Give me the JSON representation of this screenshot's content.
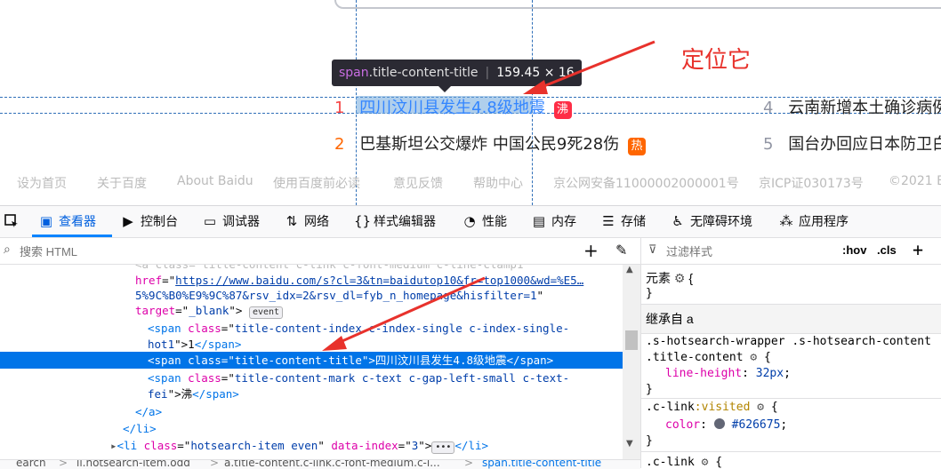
{
  "tooltip": {
    "tag": "span",
    "cls": ".title-content-title",
    "size": "159.45 × 16"
  },
  "annotation": "定位它",
  "hotsearch": [
    {
      "index": "1",
      "title": "四川汶川县发生4.8级地震",
      "badge": "沸"
    },
    {
      "index": "2",
      "title": "巴基斯坦公交爆炸 中国公民9死28伤",
      "badge": "热"
    },
    {
      "index": "4",
      "title": "云南新增本土确诊病例"
    },
    {
      "index": "5",
      "title": "国台办回应日本防卫白"
    }
  ],
  "footer": [
    "设为首页",
    "关于百度",
    "About Baidu",
    "使用百度前必读",
    "意见反馈",
    "帮助中心",
    "京公网安备11000002000001号",
    "京ICP证030173号",
    "©2021 B"
  ],
  "toolbar": {
    "inspector": "查看器",
    "console": "控制台",
    "debugger": "调试器",
    "network": "网络",
    "style_editor": "样式编辑器",
    "performance": "性能",
    "memory": "内存",
    "storage": "存储",
    "accessibility": "无障碍环境",
    "application": "应用程序"
  },
  "search_html_placeholder": "搜索 HTML",
  "filter_styles_placeholder": "过滤样式",
  "hov": ":hov",
  "cls": ".cls",
  "markup": {
    "href_value_1": "https://www.baidu.com/s?cl=3&tn=baidutop10&fr=top1000&wd=%E5…",
    "href_value_2": "5%9C%B0%E9%9C%87&rsv_idx=2&rsv_dl=fyb_n_homepage&hisfilter=1",
    "target_value": "_blank",
    "event_label": "event",
    "span1_class_1": "title-content-index c-index-single c-index-single-",
    "span1_class_2": "hot1",
    "span1_text": "1",
    "span2_class": "title-content-title",
    "span2_text": "四川汶川县发生4.8级地震",
    "span3_class_1": "title-content-mark c-text c-gap-left-small c-text-",
    "span3_class_2": "fei",
    "span3_text": "沸",
    "li_class": "hotsearch-item even",
    "li_dataindex": "3"
  },
  "rules": {
    "element_label": "元素",
    "inherited": "继承自 a",
    "selector1_a": ".s-hotsearch-wrapper .s-hotsearch-content",
    "selector1_b": ".title-content",
    "prop1": "line-height",
    "val1": "32px",
    "selector2": ".c-link",
    "pseudo2": ":visited",
    "prop2": "color",
    "val2": "#626675",
    "selector3": ".c-link"
  },
  "breadcrumb": [
    "earch",
    "li.hotsearch-item.odd",
    "a.title-content.c-link.c-font-medium.c-l...",
    "span.title-content-title"
  ],
  "colors": {
    "accent": "#0074e8",
    "annotation": "#e8322c",
    "visited": "#626675"
  }
}
